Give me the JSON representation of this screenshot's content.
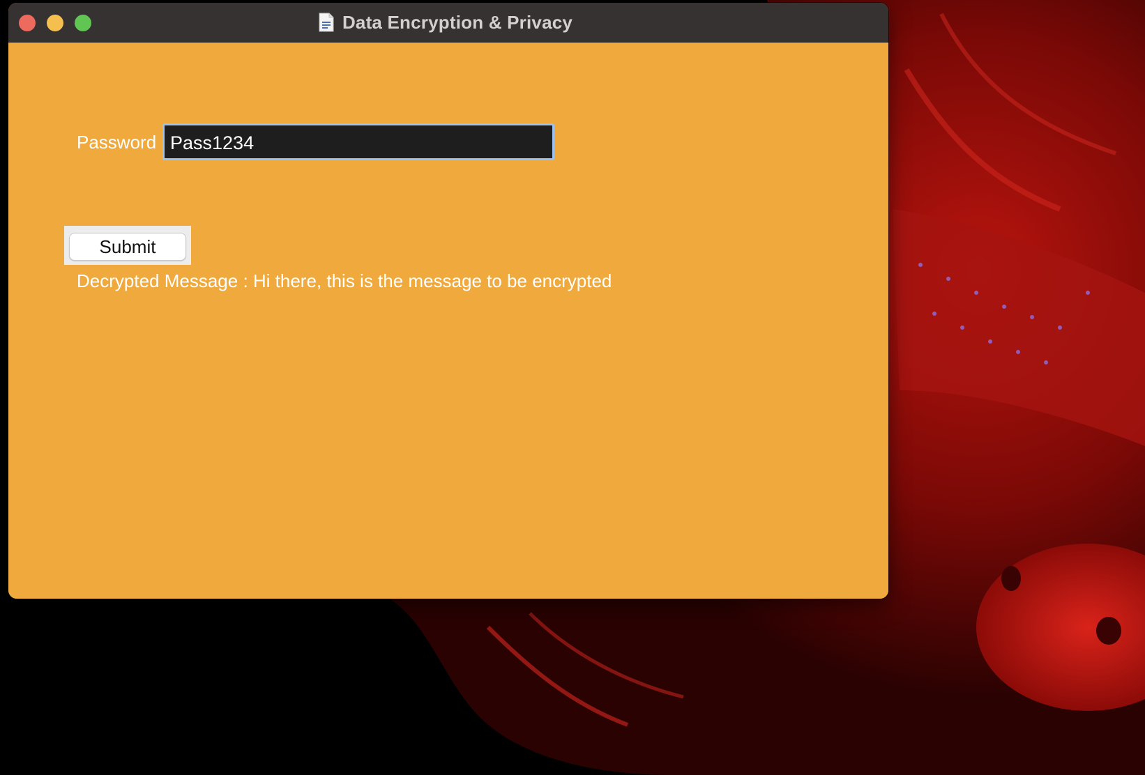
{
  "window": {
    "title": "Data Encryption & Privacy",
    "title_icon": "document-icon"
  },
  "form": {
    "password_label": "Password",
    "password_value": "Pass1234",
    "submit_label": "Submit"
  },
  "result": {
    "decrypted_message": "Decrypted Message : Hi there, this is the message to be encrypted"
  },
  "colors": {
    "window_background": "#efa93c",
    "titlebar": "#353231",
    "field_background": "#1e1e1e",
    "focus_ring": "#9cc2f3",
    "traffic_close": "#ed6a5e",
    "traffic_minimize": "#f5bf4f",
    "traffic_zoom": "#61c554"
  }
}
